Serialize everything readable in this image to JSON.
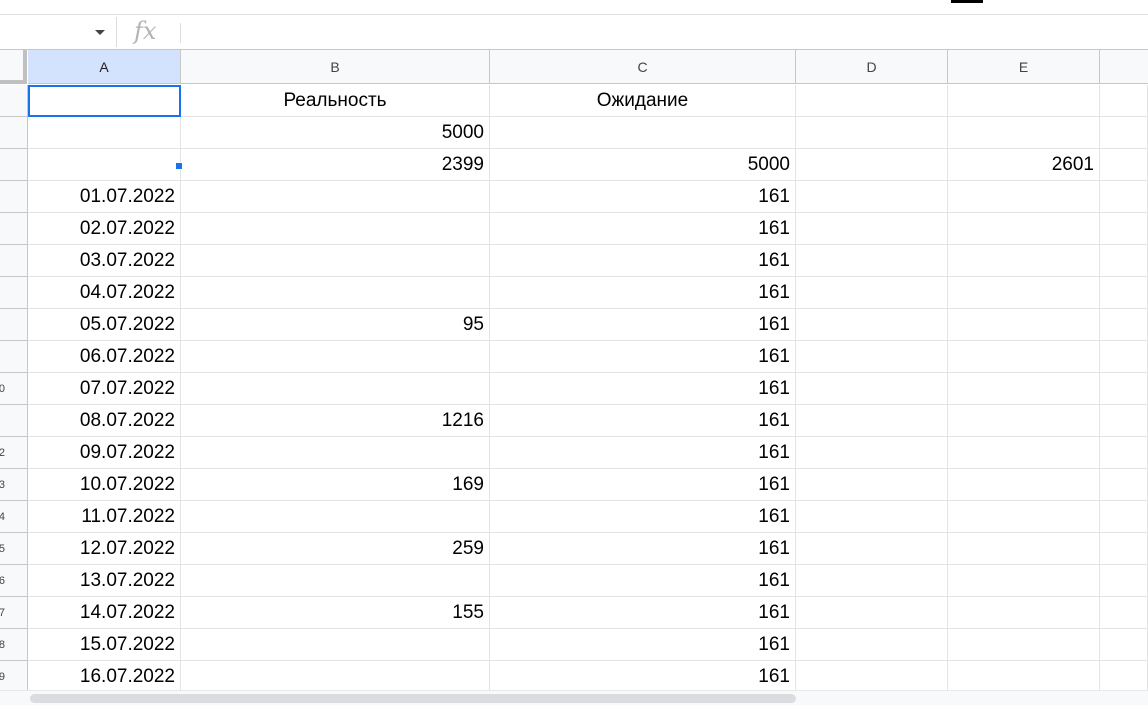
{
  "formula_bar": {
    "name_box": "",
    "fx_label": "fx",
    "content": ""
  },
  "columns": [
    "A",
    "B",
    "C",
    "D",
    "E"
  ],
  "rows": [
    {
      "num": "",
      "cells": [
        "",
        "Реальность",
        "Ожидание",
        "",
        ""
      ]
    },
    {
      "num": "",
      "cells": [
        "",
        "5000",
        "",
        "",
        ""
      ]
    },
    {
      "num": "",
      "cells": [
        "",
        "2399",
        "5000",
        "",
        "2601"
      ]
    },
    {
      "num": "",
      "cells": [
        "01.07.2022",
        "",
        "161",
        "",
        ""
      ]
    },
    {
      "num": "",
      "cells": [
        "02.07.2022",
        "",
        "161",
        "",
        ""
      ]
    },
    {
      "num": "",
      "cells": [
        "03.07.2022",
        "",
        "161",
        "",
        ""
      ]
    },
    {
      "num": "",
      "cells": [
        "04.07.2022",
        "",
        "161",
        "",
        ""
      ]
    },
    {
      "num": "",
      "cells": [
        "05.07.2022",
        "95",
        "161",
        "",
        ""
      ]
    },
    {
      "num": "",
      "cells": [
        "06.07.2022",
        "",
        "161",
        "",
        ""
      ]
    },
    {
      "num": "0",
      "cells": [
        "07.07.2022",
        "",
        "161",
        "",
        ""
      ]
    },
    {
      "num": "",
      "cells": [
        "08.07.2022",
        "1216",
        "161",
        "",
        ""
      ]
    },
    {
      "num": "2",
      "cells": [
        "09.07.2022",
        "",
        "161",
        "",
        ""
      ]
    },
    {
      "num": "3",
      "cells": [
        "10.07.2022",
        "169",
        "161",
        "",
        ""
      ]
    },
    {
      "num": "4",
      "cells": [
        "11.07.2022",
        "",
        "161",
        "",
        ""
      ]
    },
    {
      "num": "5",
      "cells": [
        "12.07.2022",
        "259",
        "161",
        "",
        ""
      ]
    },
    {
      "num": "6",
      "cells": [
        "13.07.2022",
        "",
        "161",
        "",
        ""
      ]
    },
    {
      "num": "7",
      "cells": [
        "14.07.2022",
        "155",
        "161",
        "",
        ""
      ]
    },
    {
      "num": "8",
      "cells": [
        "15.07.2022",
        "",
        "161",
        "",
        ""
      ]
    },
    {
      "num": "9",
      "cells": [
        "16.07.2022",
        "",
        "161",
        "",
        ""
      ]
    }
  ],
  "colors": {
    "selection": "#1a73e8",
    "header_bg": "#f8f9fa",
    "header_selected_bg": "#d3e3fd",
    "gridline": "#e2e3e3"
  }
}
